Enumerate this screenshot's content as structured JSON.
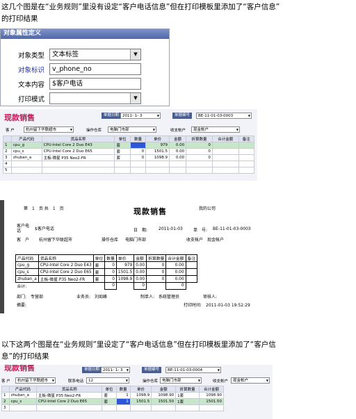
{
  "text": {
    "para1_line1": "这几个图是在“业务规则”里没有设定“客户电话信息”但在打印模板里添加了“客户信息”",
    "para1_line2": "的打印结果",
    "para2_line1": "以下这两个图是在“业务规则”里设定了“客户电话信息”但在打印模板里添加了“客户信",
    "para2_line2": "息”的打印结果"
  },
  "props_panel": {
    "title": "对象属性定义",
    "rows": [
      {
        "label": "对象类型",
        "value": "文本标签",
        "dropdown": true
      },
      {
        "label": "对象标识",
        "value": "v_phone_no",
        "dropdown": false
      },
      {
        "label": "文本内容",
        "value": "$客户电话",
        "dropdown": false
      },
      {
        "label": "打印模式",
        "value": "",
        "dropdown": true
      }
    ]
  },
  "sales_form": {
    "title": "现款销售",
    "date_label": "单据日期",
    "date_value": "2011- 1- 3",
    "no_label": "单据编号",
    "no_value": "BE-11-01-03-0003",
    "customer_label": "客 户",
    "customer_value": "杭州留下华联超市",
    "warehouse_label": "操作仓库",
    "warehouse_value": "电脑门市部",
    "account_label": "收支帐户",
    "account_value": "现金帐户",
    "columns": [
      "",
      "产品代码",
      "货品名称",
      "单位",
      "数量",
      "单价",
      "金额",
      "折算数量",
      "合计金额",
      "备注"
    ],
    "rows": [
      [
        "1",
        "cpu_g",
        "CPU-Intel Core 2 Duo E43",
        "套",
        "",
        "979",
        "0.00",
        "0",
        "",
        ""
      ],
      [
        "2",
        "cpu_s",
        "CPU-Intel Core 2 Duo E65",
        "套",
        "0",
        "1501.5",
        "0.00",
        "0",
        "",
        ""
      ],
      [
        "3",
        "zhuban_a",
        "主板-微星 P35 Neo2-FR",
        "套",
        "0",
        "1098.9",
        "0.00",
        "0",
        "",
        ""
      ],
      [
        "4",
        "",
        "",
        "",
        "",
        "",
        "",
        "",
        "",
        ""
      ],
      [
        "5",
        "",
        "",
        "",
        "",
        "",
        "",
        "",
        "",
        ""
      ]
    ]
  },
  "print_preview": {
    "page_label": "第",
    "page_no": "1",
    "page_of": "页 共",
    "page_total": "1",
    "page_end": "页",
    "company": "我的公司",
    "title": "现款销售",
    "phone_label": "客户电话",
    "phone_value": "$客户电话",
    "date_label": "日　期:",
    "date_value": "2011-01-03",
    "no_label": "单　号:",
    "no_value": "BE-11-01-03-0003",
    "customer_label": "客　户",
    "customer_value": "杭州留下华联超市",
    "warehouse_label": "操作仓库",
    "warehouse_value": "电脑门市部",
    "account_label": "收支帐户",
    "account_value": "现金帐户",
    "columns": [
      "产品代码",
      "货品名称",
      "单位",
      "数量",
      "单价",
      "金额",
      "折算数量",
      "合计金额",
      "备注"
    ],
    "rows": [
      [
        "cpu_g",
        "CPU-Intel Core 2 Duo E43",
        "套",
        "0",
        "979",
        "0.00",
        "0",
        "0.00",
        ""
      ],
      [
        "cpu_s",
        "CPU-Intel Core 2 Duo E65",
        "套",
        "0",
        "1501.5",
        "0.00",
        "0",
        "0.00",
        ""
      ],
      [
        "zhuban_a",
        "主板-微星 P35 Neo2-FR",
        "套",
        "0",
        "1098.9",
        "0.00",
        "0",
        "0.00",
        ""
      ]
    ],
    "total_label": "合计:",
    "total_qty": "0",
    "total_conv": "0",
    "total_sum": "0",
    "dept_label": "部门:",
    "dept_value": "专营部",
    "sales_label": "业务员:",
    "sales_value": "刘如峰",
    "maker_label": "制单人:",
    "maker_value": "系统管理员",
    "audit_label": "审核人:",
    "memo_label": "摘要:",
    "print_time_label": "打印时间:",
    "print_time_value": "2011-01-03 19:52:29"
  },
  "sales_form2": {
    "title": "现款销售",
    "date_label": "单据日期",
    "date_value": "2011- 1- 3",
    "no_label": "单据编号",
    "no_value": "BE-11-01-03-0004",
    "customer_label": "客 户",
    "customer_value": "杭州留下华联超市",
    "phone_label": "联系电话",
    "phone_value": "12",
    "warehouse_label": "操作仓库",
    "warehouse_value": "电脑门市部",
    "account_label": "收支帐户",
    "account_value": "现金帐户",
    "columns": [
      "",
      "产品代码",
      "货品名称",
      "单位",
      "数量",
      "单价",
      "金额",
      "折算数量",
      "合计金额"
    ],
    "rows": [
      [
        "1",
        "zhuban_a",
        "主板-微星 P35 Neo2-FR",
        "套",
        "1",
        "1098.9",
        "1098.90",
        "1套",
        "1098.90"
      ],
      [
        "2",
        "cpu_s",
        "CPU-Intel Core 2 Duo E65",
        "套",
        "1",
        "1501.5",
        "1501.50",
        "1套",
        "1501.50"
      ],
      [
        "3",
        "",
        "",
        "",
        "",
        "",
        "",
        "",
        ""
      ]
    ]
  }
}
